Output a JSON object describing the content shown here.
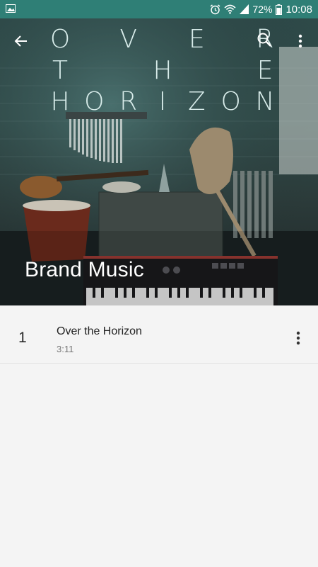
{
  "status_bar": {
    "battery_percent": "72%",
    "time": "10:08",
    "icons": [
      "image-icon",
      "alarm-icon",
      "wifi-icon",
      "signal-icon",
      "battery-icon"
    ]
  },
  "toolbar": {
    "back_icon": "arrow-back-icon",
    "search_icon": "search-icon",
    "more_icon": "more-vertical-icon"
  },
  "cover": {
    "line1": [
      "O",
      "V",
      "E",
      "R"
    ],
    "line2": [
      "T",
      "H",
      "E"
    ],
    "line3": [
      "H",
      "O",
      "R",
      "I",
      "Z",
      "O",
      "N"
    ]
  },
  "album": {
    "title": "Brand Music"
  },
  "tracks": [
    {
      "number": "1",
      "title": "Over the Horizon",
      "duration": "3:11"
    }
  ],
  "colors": {
    "status_bar": "#2f7f76",
    "background": "#f4f4f4",
    "cover_text": "#d8ecea"
  }
}
